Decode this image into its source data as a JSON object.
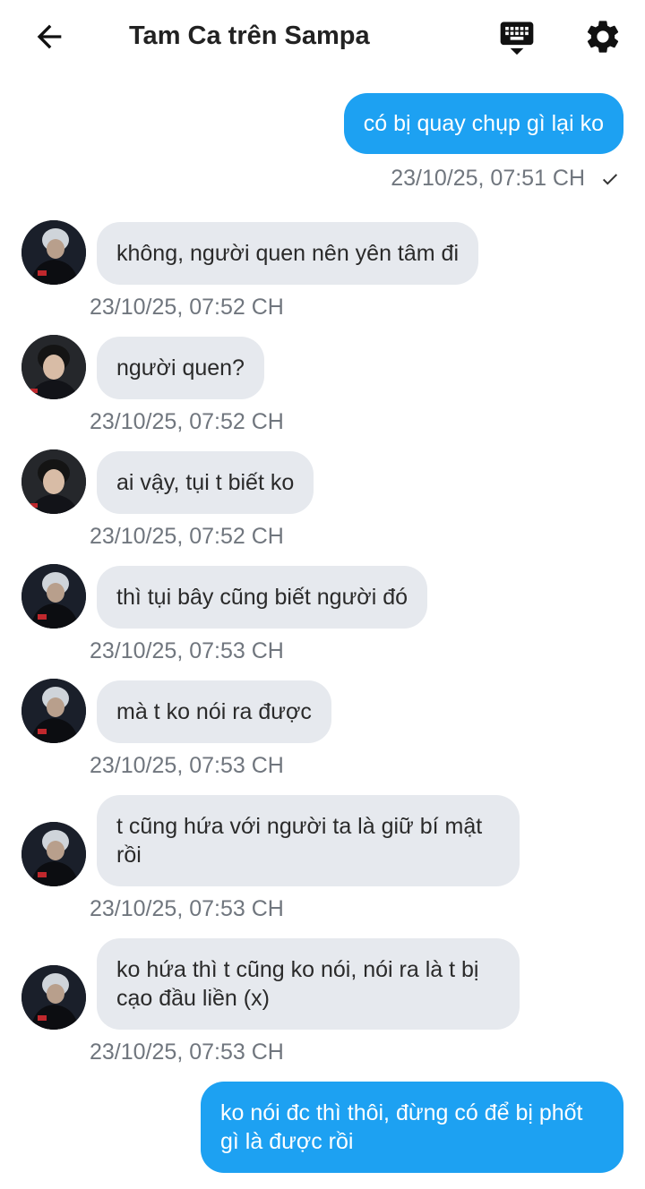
{
  "header": {
    "title": "Tam Ca trên Sampa",
    "back_icon": "arrow-left-icon",
    "keyboard_icon": "keyboard-icon",
    "settings_icon": "gear-icon"
  },
  "colors": {
    "outgoing_bubble": "#1da1f2",
    "incoming_bubble": "#e6e9ee",
    "timestamp": "#70767e"
  },
  "messages": [
    {
      "direction": "out",
      "text": "có bị quay chụp gì lại ko",
      "time": "23/10/25, 07:51 CH",
      "status_icon": "checkmark-icon"
    },
    {
      "direction": "in",
      "text": "không, người quen nên yên tâm đi",
      "time": "23/10/25, 07:52 CH"
    },
    {
      "direction": "in",
      "text": "người quen?",
      "time": "23/10/25, 07:52 CH"
    },
    {
      "direction": "in",
      "text": "ai vậy, tụi t biết ko",
      "time": "23/10/25, 07:52 CH"
    },
    {
      "direction": "in",
      "text": "thì tụi bây cũng biết người đó",
      "time": "23/10/25, 07:53 CH"
    },
    {
      "direction": "in",
      "text": "mà t ko nói ra được",
      "time": "23/10/25, 07:53 CH"
    },
    {
      "direction": "in",
      "text": "t cũng hứa với người ta là giữ bí mật rồi",
      "time": "23/10/25, 07:53 CH"
    },
    {
      "direction": "in",
      "text": "ko hứa thì t cũng ko nói, nói ra là t bị cạo đầu liền (x)",
      "time": "23/10/25, 07:53 CH"
    },
    {
      "direction": "out",
      "text": "ko nói đc thì thôi, đừng có để bị phốt gì là được rồi"
    }
  ]
}
